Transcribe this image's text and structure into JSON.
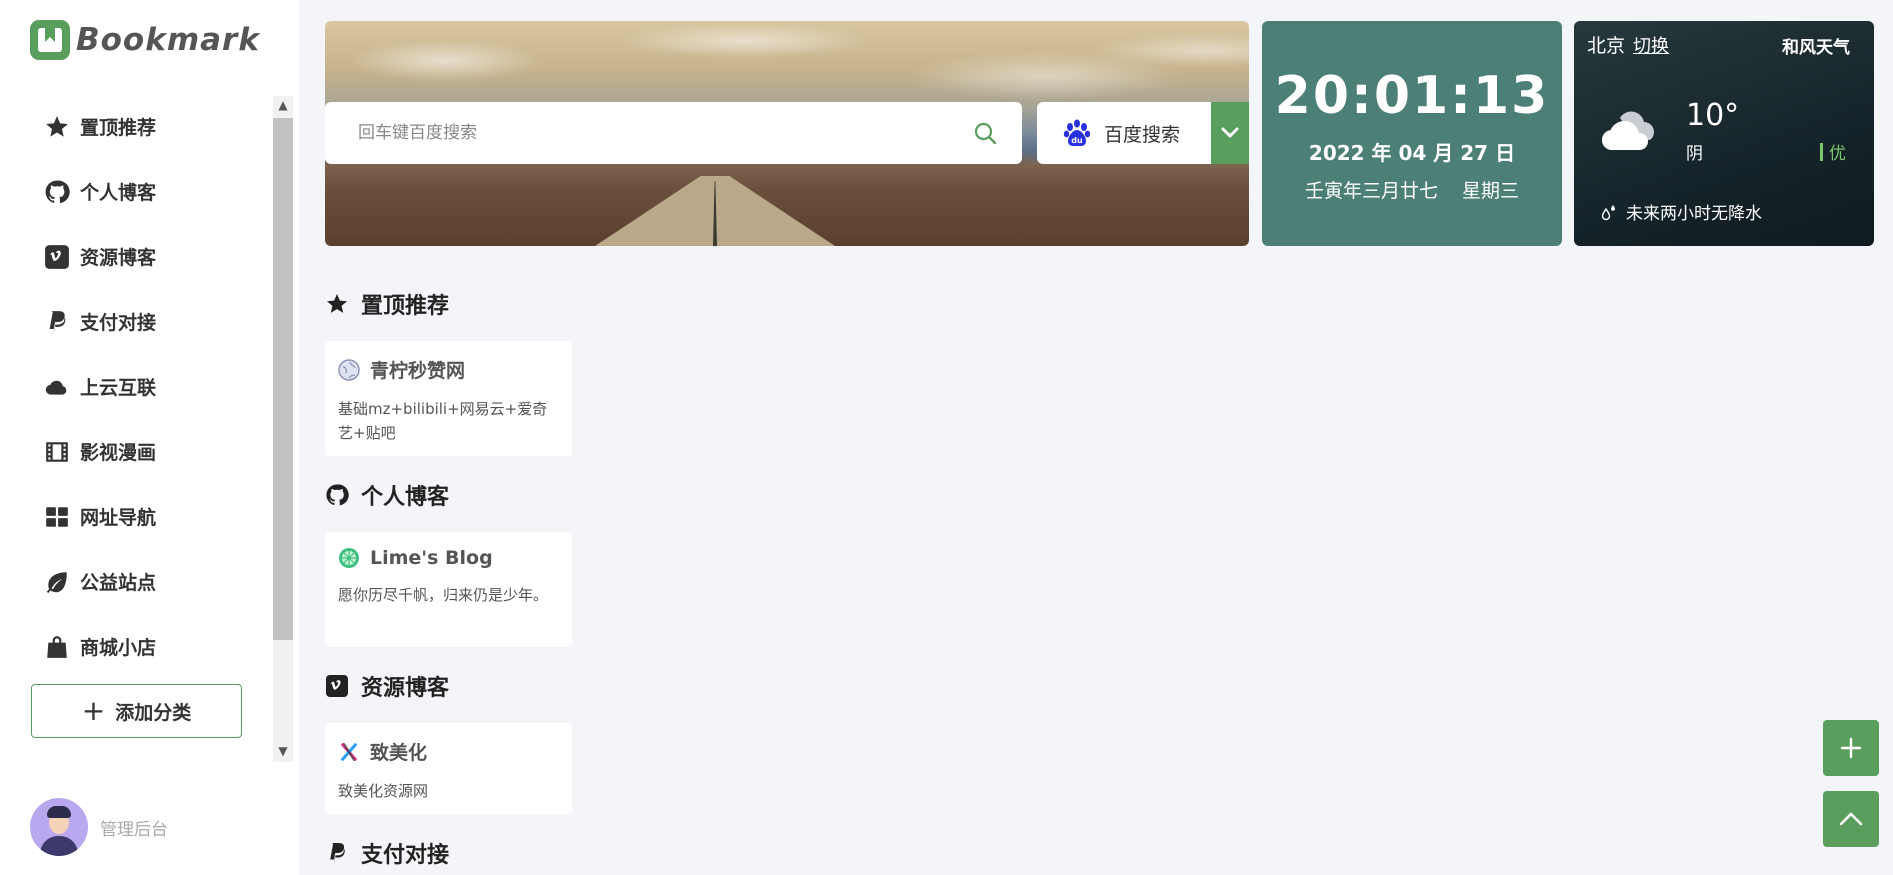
{
  "brand": {
    "name": "Bookmark"
  },
  "sidebar": {
    "items": [
      {
        "label": "置顶推荐",
        "icon": "star-icon"
      },
      {
        "label": "个人博客",
        "icon": "github-icon"
      },
      {
        "label": "资源博客",
        "icon": "vimeo-icon"
      },
      {
        "label": "支付对接",
        "icon": "paypal-icon"
      },
      {
        "label": "上云互联",
        "icon": "cloud-icon"
      },
      {
        "label": "影视漫画",
        "icon": "film-icon"
      },
      {
        "label": "网址导航",
        "icon": "grid-icon"
      },
      {
        "label": "公益站点",
        "icon": "leaf-icon"
      },
      {
        "label": "商城小店",
        "icon": "shopping-bag-icon"
      }
    ],
    "add_category_label": "添加分类",
    "admin_label": "管理后台"
  },
  "search": {
    "placeholder": "回车键百度搜索",
    "engine_label": "百度搜索"
  },
  "clock": {
    "time": "20:01:13",
    "date": "2022 年 04 月 27 日",
    "lunar": "壬寅年三月廿七",
    "weekday": "星期三"
  },
  "weather": {
    "city": "北京",
    "switch_label": "切换",
    "provider": "和风天气",
    "temperature": "10°",
    "condition": "阴",
    "aqi": "优",
    "rain_note": "未来两小时无降水"
  },
  "sections": [
    {
      "title": "置顶推荐",
      "icon": "star-icon",
      "cards": [
        {
          "name": "青柠秒赞网",
          "desc": "基础mz+bilibili+网易云+爱奇艺+贴吧"
        }
      ]
    },
    {
      "title": "个人博客",
      "icon": "github-icon",
      "cards": [
        {
          "name": "Lime's Blog",
          "desc": "愿你历尽千帆，归来仍是少年。"
        }
      ]
    },
    {
      "title": "资源博客",
      "icon": "vimeo-icon",
      "cards": [
        {
          "name": "致美化",
          "desc": "致美化资源网"
        }
      ]
    },
    {
      "title": "支付对接",
      "icon": "paypal-icon",
      "cards": []
    }
  ],
  "colors": {
    "accent": "#5a9e5e",
    "clock_bg": "#4c7f76",
    "weather_bg": "#15242a",
    "page_bg": "#f4f5f9"
  }
}
